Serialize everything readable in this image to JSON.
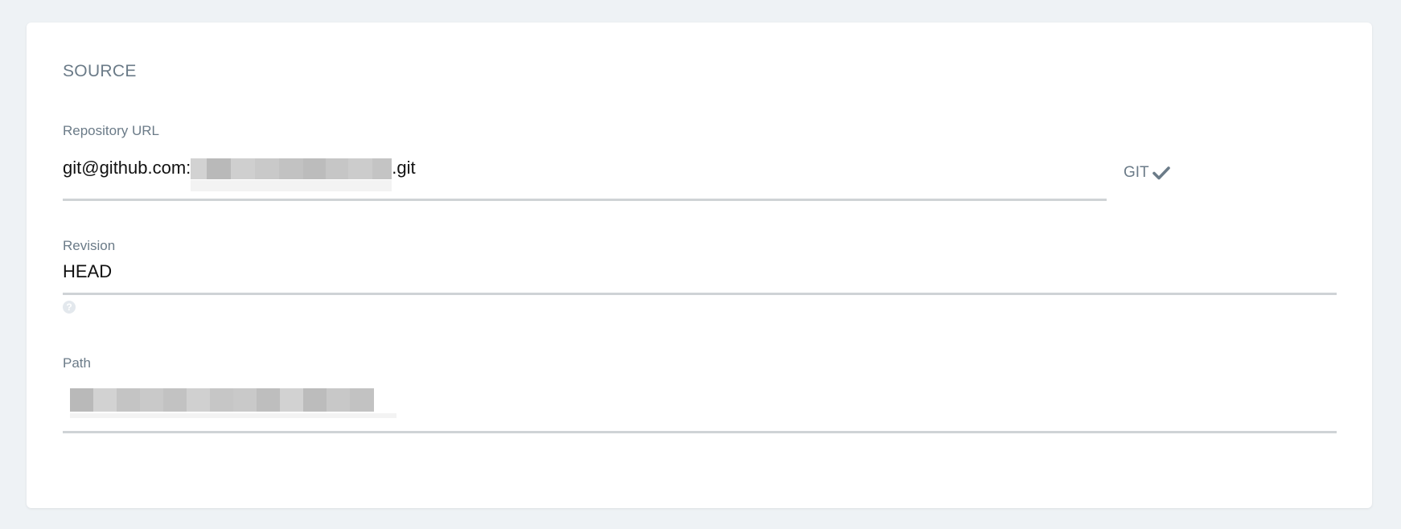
{
  "section": {
    "title": "SOURCE"
  },
  "repository_url": {
    "label": "Repository URL",
    "value_prefix": "git@github.com:",
    "value_suffix": ".git",
    "type_badge": "GIT"
  },
  "revision": {
    "label": "Revision",
    "value": "HEAD",
    "help_icon": "question-circle-icon"
  },
  "path": {
    "label": "Path"
  },
  "colors": {
    "background": "#eef2f5",
    "card": "#ffffff",
    "label": "#6b7b88",
    "underline": "#cfd3d6",
    "value": "#111111"
  }
}
